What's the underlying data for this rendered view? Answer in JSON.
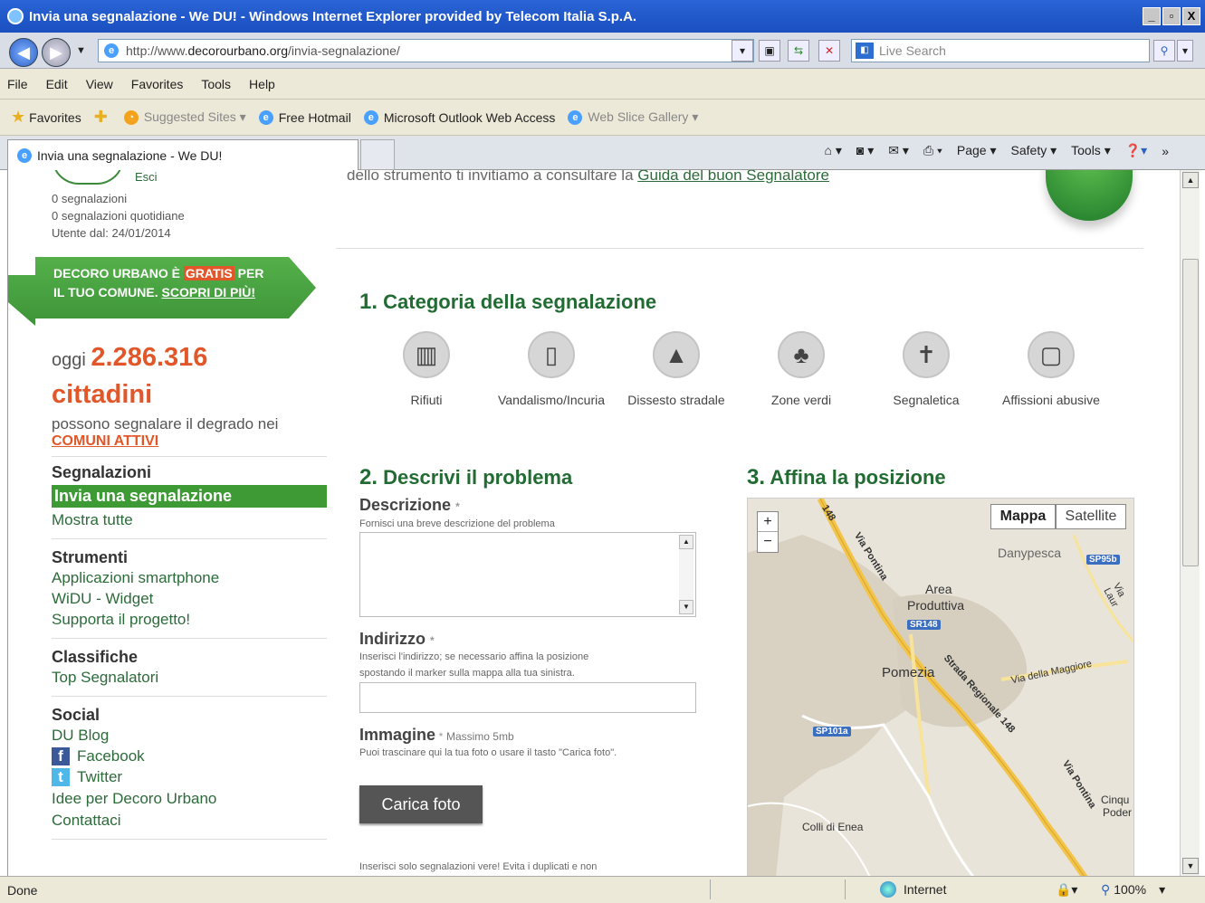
{
  "window": {
    "title": "Invia una segnalazione - We DU! - Windows Internet Explorer provided by Telecom Italia S.p.A.",
    "min": "_",
    "max": "▫",
    "close": "X"
  },
  "address": {
    "url_prefix": "http://www.",
    "url_domain": "decorourbano.org",
    "url_path": "/invia-segnalazione/",
    "search_placeholder": "Live Search"
  },
  "menu": [
    "File",
    "Edit",
    "View",
    "Favorites",
    "Tools",
    "Help"
  ],
  "favorites": {
    "favorites_label": "Favorites",
    "items": [
      "Suggested Sites ▾",
      "Free Hotmail",
      "Microsoft Outlook Web Access",
      "Web Slice Gallery ▾"
    ]
  },
  "tab": {
    "title": "Invia una segnalazione - We DU!"
  },
  "commandbar": [
    "Page ▾",
    "Safety ▾",
    "Tools ▾"
  ],
  "status": {
    "text": "Done",
    "zone": "Internet",
    "zoom": "100%"
  },
  "sidebar": {
    "logout": "Esci",
    "stats": [
      "0 segnalazioni",
      "0 segnalazioni quotidiane",
      "Utente dal: 24/01/2014"
    ],
    "banner_line1_a": "DECORO URBANO È ",
    "banner_gratis": "GRATIS",
    "banner_line1_b": " PER",
    "banner_line2_a": "IL TUO COMUNE. ",
    "banner_link": "SCOPRI DI PIÙ!",
    "today_label": "oggi ",
    "today_count": "2.286.316",
    "citizens": "cittadini",
    "can_report": "possono segnalare il degrado nei",
    "active_link": "COMUNI ATTIVI",
    "sections": [
      {
        "title": "Segnalazioni",
        "items": [
          "Invia una segnalazione",
          "Mostra tutte"
        ]
      },
      {
        "title": "Strumenti",
        "items": [
          "Applicazioni smartphone",
          "WiDU - Widget",
          "Supporta il progetto!"
        ]
      },
      {
        "title": "Classifiche",
        "items": [
          "Top Segnalatori"
        ]
      },
      {
        "title": "Social",
        "items": [
          "DU Blog",
          "Facebook",
          "Twitter",
          "Idee per Decoro Urbano",
          "Contattaci"
        ]
      }
    ]
  },
  "main": {
    "intro_text": "dello strumento ti invitiamo a consultare la ",
    "intro_link": "Guida del buon Segnalatore",
    "step1_num": "1.",
    "step1_title": "Categoria della segnalazione",
    "categories": [
      "Rifiuti",
      "Vandalismo/Incuria",
      "Dissesto stradale",
      "Zone verdi",
      "Segnaletica",
      "Affissioni abusive"
    ],
    "step2_num": "2.",
    "step2_title": "Descrivi il problema",
    "desc_label": "Descrizione",
    "desc_help": "Fornisci una breve descrizione del problema",
    "addr_label": "Indirizzo",
    "addr_help1": "Inserisci l'indirizzo; se necessario affina la posizione",
    "addr_help2": "spostando il marker sulla mappa alla tua sinistra.",
    "img_label": "Immagine",
    "img_max": "Massimo 5mb",
    "img_help": "Puoi trascinare qui la tua foto o usare il tasto \"Carica foto\".",
    "upload_btn": "Carica foto",
    "footer_note": "Inserisci solo segnalazioni vere! Evita i duplicati e non",
    "step3_num": "3.",
    "step3_title": "Affina la posizione",
    "map": {
      "mappa": "Mappa",
      "satellite": "Satellite",
      "zoom_in": "+",
      "zoom_out": "−",
      "labels": [
        "Danypesca",
        "Area",
        "Produttiva",
        "Pomezia",
        "Colli di Enea",
        "Cinqu",
        "Poder",
        "Via Pontina",
        "Strada Regionale 148",
        "Via della Maggiore",
        "Via Laur",
        "148"
      ],
      "signs": [
        "SP95b",
        "SR148",
        "SP101a"
      ]
    }
  }
}
